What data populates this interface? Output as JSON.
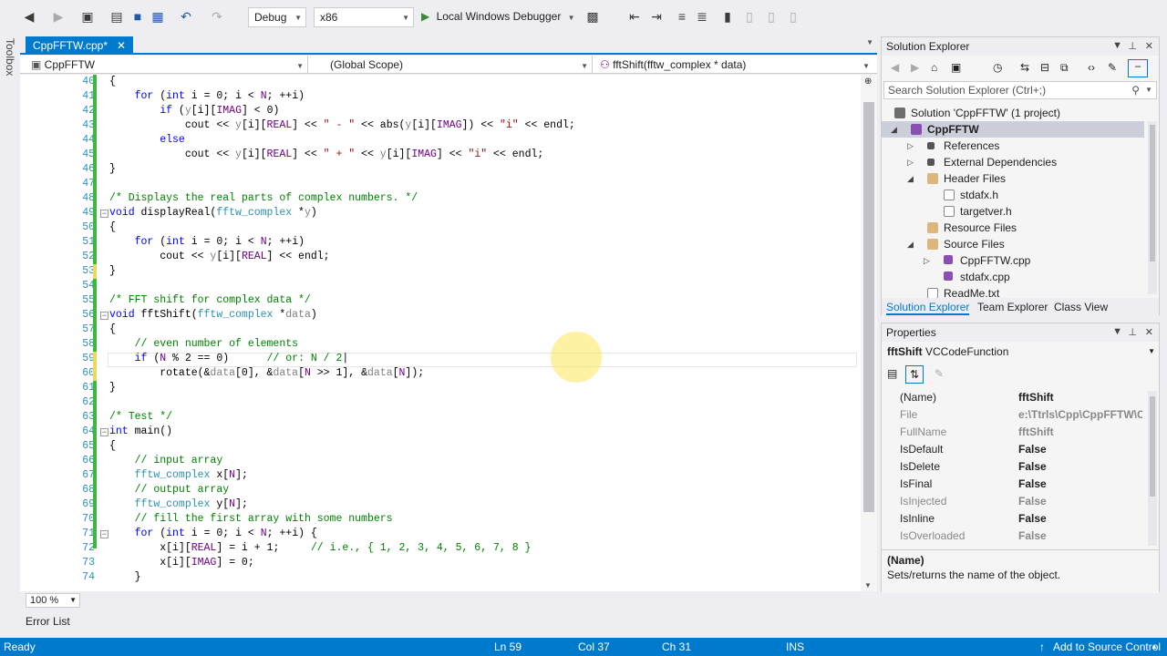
{
  "toolbar": {
    "config": "Debug",
    "platform": "x86",
    "run_label": "Local Windows Debugger"
  },
  "toolbox": {
    "label": "Toolbox"
  },
  "tab": {
    "title": "CppFFTW.cpp*",
    "close": "✕"
  },
  "nav": {
    "project": "CppFFTW",
    "scope": "(Global Scope)",
    "member": "fftShift(fftw_complex * data)"
  },
  "editor": {
    "line_numbers": [
      "40",
      "41",
      "42",
      "43",
      "44",
      "45",
      "46",
      "47",
      "48",
      "49",
      "50",
      "51",
      "52",
      "53",
      "54",
      "55",
      "56",
      "57",
      "58",
      "59",
      "60",
      "61",
      "62",
      "63",
      "64",
      "65",
      "66",
      "67",
      "68",
      "69",
      "70",
      "71",
      "72",
      "73",
      "74"
    ],
    "zoom": "100 %"
  },
  "errorlist": {
    "label": "Error List"
  },
  "status": {
    "ready": "Ready",
    "ln": "Ln 59",
    "col": "Col 37",
    "ch": "Ch 31",
    "ins": "INS",
    "source": "Add to Source Control"
  },
  "solution_explorer": {
    "title": "Solution Explorer",
    "search_placeholder": "Search Solution Explorer (Ctrl+;)",
    "items": [
      {
        "label": "Solution 'CppFFTW' (1 project)"
      },
      {
        "label": "CppFFTW"
      },
      {
        "label": "References"
      },
      {
        "label": "External Dependencies"
      },
      {
        "label": "Header Files"
      },
      {
        "label": "stdafx.h"
      },
      {
        "label": "targetver.h"
      },
      {
        "label": "Resource Files"
      },
      {
        "label": "Source Files"
      },
      {
        "label": "CppFFTW.cpp"
      },
      {
        "label": "stdafx.cpp"
      },
      {
        "label": "ReadMe.txt"
      }
    ],
    "tabs": [
      "Solution Explorer",
      "Team Explorer",
      "Class View"
    ]
  },
  "properties": {
    "title": "Properties",
    "object_name": "fftShift",
    "object_type": "VCCodeFunction",
    "rows": [
      {
        "name": "(Name)",
        "value": "fftShift"
      },
      {
        "name": "File",
        "value": "e:\\Ttrls\\Cpp\\CppFFTW\\C"
      },
      {
        "name": "FullName",
        "value": "fftShift"
      },
      {
        "name": "IsDefault",
        "value": "False"
      },
      {
        "name": "IsDelete",
        "value": "False"
      },
      {
        "name": "IsFinal",
        "value": "False"
      },
      {
        "name": "IsInjected",
        "value": "False"
      },
      {
        "name": "IsInline",
        "value": "False"
      },
      {
        "name": "IsOverloaded",
        "value": "False"
      }
    ],
    "desc_title": "(Name)",
    "desc_text": "Sets/returns the name of the object."
  },
  "colors": {
    "accent": "#007acc",
    "keyword": "#0000ff",
    "comment": "#008000",
    "string": "#a31515",
    "type": "#2b91af"
  }
}
